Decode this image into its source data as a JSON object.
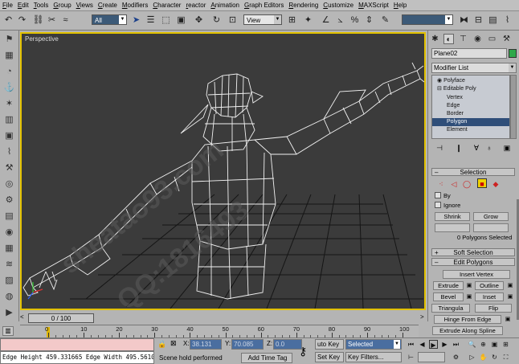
{
  "menu": [
    "File",
    "Edit",
    "Tools",
    "Group",
    "Views",
    "Create",
    "Modifiers",
    "Character",
    "reactor",
    "Animation",
    "Graph Editors",
    "Rendering",
    "Customize",
    "MAXScript",
    "Help"
  ],
  "toolbar": {
    "selection_filter": "All",
    "reference_coord": "View"
  },
  "viewport": {
    "label": "Perspective",
    "watermark_lines": [
      "sheatao93.com",
      "QQ:1816493"
    ]
  },
  "command_panel": {
    "object_name": "Plane02",
    "object_color": "#2fa84a",
    "modifier_list": "Modifier List",
    "stack": [
      {
        "label": "Polyface",
        "indent": 1,
        "selected": false
      },
      {
        "label": "Editable Poly",
        "indent": 1,
        "selected": false
      },
      {
        "label": "Vertex",
        "indent": 2,
        "selected": false
      },
      {
        "label": "Edge",
        "indent": 2,
        "selected": false
      },
      {
        "label": "Border",
        "indent": 2,
        "selected": false
      },
      {
        "label": "Polygon",
        "indent": 2,
        "selected": true
      },
      {
        "label": "Element",
        "indent": 2,
        "selected": false
      }
    ],
    "selection_rollout": {
      "title": "Selection",
      "by_label": "By",
      "ignore_label": "Ignore",
      "shrink": "Shrink",
      "grow": "Grow",
      "info": "0 Polygons Selected"
    },
    "soft_selection": "Soft Selection",
    "edit_polygons": {
      "title": "Edit Polygons",
      "insert_vertex": "Insert Vertex",
      "extrude": "Extrude",
      "outline": "Outline",
      "bevel": "Bevel",
      "inset": "Inset",
      "triangulate": "Triangula",
      "flip": "Flip",
      "hinge": "Hinge From Edge",
      "extrude_spline": "Extrude Along Spline"
    }
  },
  "timeline": {
    "frame_display": "0 / 100",
    "ticks": [
      "0",
      "10",
      "20",
      "30",
      "40",
      "50",
      "60",
      "70",
      "80",
      "90",
      "100"
    ]
  },
  "status": {
    "listener_text": "Edge Height 459.331665 Edge Width 495.5610",
    "x_label": "X:",
    "x_value": "38.131",
    "y_label": "Y:",
    "y_value": "70.085",
    "z_label": "Z:",
    "z_value": "0.0",
    "prompt": "Scene hold performed",
    "add_time_tag": "Add Time Tag",
    "auto_key": "uto Key",
    "set_key": "Set Key",
    "key_mode": "Selected",
    "key_filters": "Key Filters..."
  }
}
